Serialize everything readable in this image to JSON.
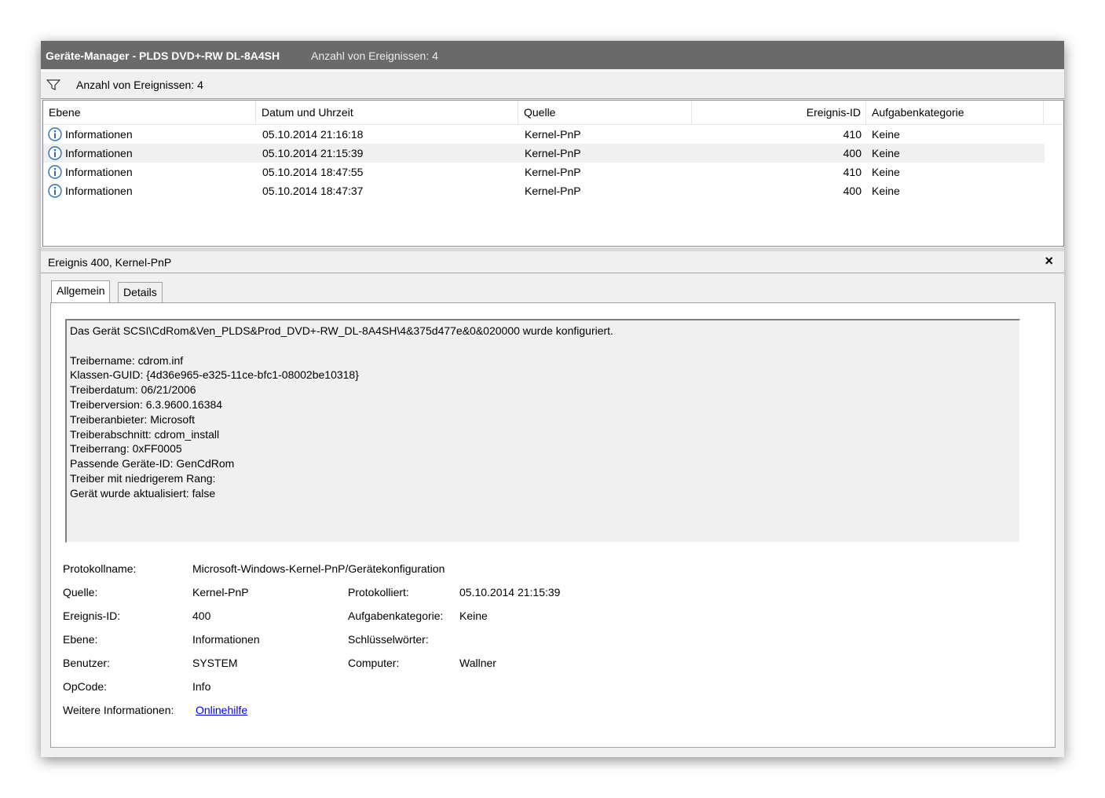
{
  "window": {
    "title": "Geräte-Manager - PLDS DVD+-RW DL-8A4SH",
    "title_count": "Anzahl von Ereignissen: 4"
  },
  "filter": {
    "icon": "filter-icon",
    "text": "Anzahl von Ereignissen: 4"
  },
  "table": {
    "columns": [
      "Ebene",
      "Datum und Uhrzeit",
      "Quelle",
      "Ereignis-ID",
      "Aufgabenkategorie"
    ],
    "rows": [
      {
        "level": "Informationen",
        "datetime": "05.10.2014 21:16:18",
        "source": "Kernel-PnP",
        "event_id": "410",
        "category": "Keine",
        "selected": false
      },
      {
        "level": "Informationen",
        "datetime": "05.10.2014 21:15:39",
        "source": "Kernel-PnP",
        "event_id": "400",
        "category": "Keine",
        "selected": true
      },
      {
        "level": "Informationen",
        "datetime": "05.10.2014 18:47:55",
        "source": "Kernel-PnP",
        "event_id": "410",
        "category": "Keine",
        "selected": false
      },
      {
        "level": "Informationen",
        "datetime": "05.10.2014 18:47:37",
        "source": "Kernel-PnP",
        "event_id": "400",
        "category": "Keine",
        "selected": false
      }
    ]
  },
  "detail": {
    "title": "Ereignis 400, Kernel-PnP",
    "close": "×",
    "tabs": [
      "Allgemein",
      "Details"
    ],
    "active_tab": "Allgemein",
    "message_lines": [
      "Das Gerät SCSI\\CdRom&Ven_PLDS&Prod_DVD+-RW_DL-8A4SH\\4&375d477e&0&020000 wurde konfiguriert.",
      "",
      "Treibername: cdrom.inf",
      "Klassen-GUID: {4d36e965-e325-11ce-bfc1-08002be10318}",
      "Treiberdatum: 06/21/2006",
      "Treiberversion: 6.3.9600.16384",
      "Treiberanbieter: Microsoft",
      "Treiberabschnitt: cdrom_install",
      "Treiberrang: 0xFF0005",
      "Passende Geräte-ID: GenCdRom",
      "Treiber mit niedrigerem Rang:",
      "Gerät wurde aktualisiert: false"
    ],
    "props": {
      "log_name_label": "Protokollname:",
      "log_name": "Microsoft-Windows-Kernel-PnP/Gerätekonfiguration",
      "source_label": "Quelle:",
      "source": "Kernel-PnP",
      "logged_label": "Protokolliert:",
      "logged": "05.10.2014 21:15:39",
      "event_id_label": "Ereignis-ID:",
      "event_id": "400",
      "task_label": "Aufgabenkategorie:",
      "task": "Keine",
      "level_label": "Ebene:",
      "level": "Informationen",
      "keywords_label": "Schlüsselwörter:",
      "keywords": "",
      "user_label": "Benutzer:",
      "user": "SYSTEM",
      "computer_label": "Computer:",
      "computer": "Wallner",
      "opcode_label": "OpCode:",
      "opcode": "Info",
      "more_info_label": "Weitere Informationen:",
      "more_info_link": "Onlinehilfe"
    }
  },
  "colors": {
    "titlebar": "#6a6a6a",
    "info_icon": "#2b6cc4",
    "selected_row": "#f0f0f0",
    "link": "#0000ee"
  }
}
